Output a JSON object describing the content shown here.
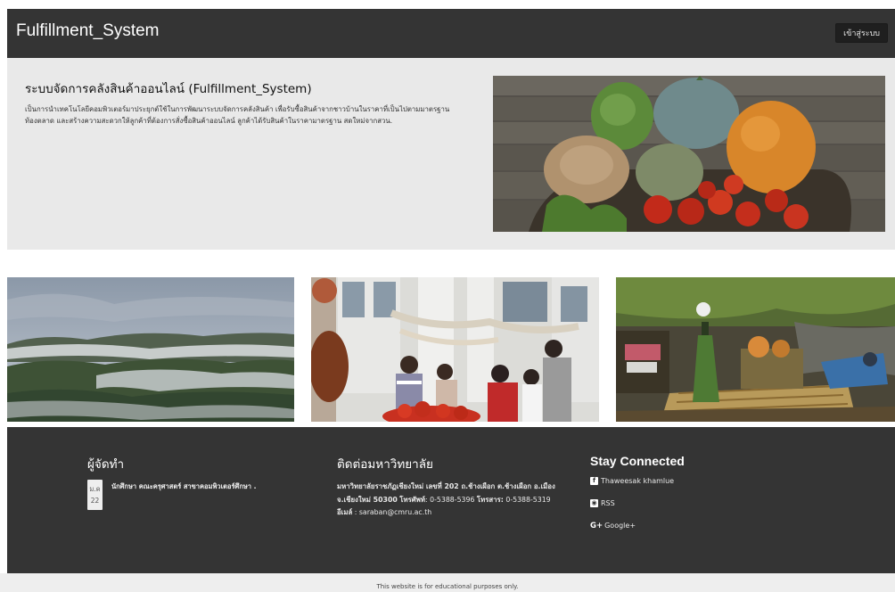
{
  "navbar": {
    "brand": "Fulfillment_System",
    "login_label": "เข้าสู่ระบบ"
  },
  "hero": {
    "title": "ระบบจัดการคลังสินค้าออนไลน์ (Fulfillment_System)",
    "description": "เป็นการนำเทคโนโลยีคอมพิวเตอร์มาประยุกต์ใช้ในการพัฒนาระบบจัดการคลังสินค้า เพื่อรับซื้อสินค้าจากชาวบ้านในราคาที่เป็นไปตามมาตรฐานท้องตลาด และสร้างความสะดวกให้ลูกค้าที่ต้องการสั่งซื้อสินค้าออนไลน์ ลูกค้าได้รับสินค้าในราคามาตรฐาน สดใหม่จากสวน."
  },
  "footer": {
    "col1": {
      "heading": "ผู้จัดทำ",
      "date_month": "ม.ค",
      "date_day": "22",
      "person": "นักศึกษา คณะครุศาสตร์ สาขาคอมพิวเตอร์ศึกษา ."
    },
    "col2": {
      "heading": "ติดต่อมหาวิทยาลัย",
      "address": "มหาวิทยาลัยราชภัฏเชียงใหม่ เลขที่ 202 ถ.ช้างเผือก ต.ช้างเผือก อ.เมือง จ.เชียงใหม่ 50300",
      "phone_label": "โทรศัพท์",
      "phone": ": 0-5388-5396",
      "fax_label": "โทรสาร:",
      "fax": " 0-5388-5319",
      "email_label": "อีเมล์",
      "email": " : saraban@cmru.ac.th"
    },
    "col3": {
      "heading": "Stay Connected",
      "links": [
        {
          "label": "Thaweesak khamlue"
        },
        {
          "label": "RSS"
        },
        {
          "label": "Google+"
        }
      ]
    }
  },
  "bottom": {
    "notice": "This website is for educational purposes only."
  }
}
